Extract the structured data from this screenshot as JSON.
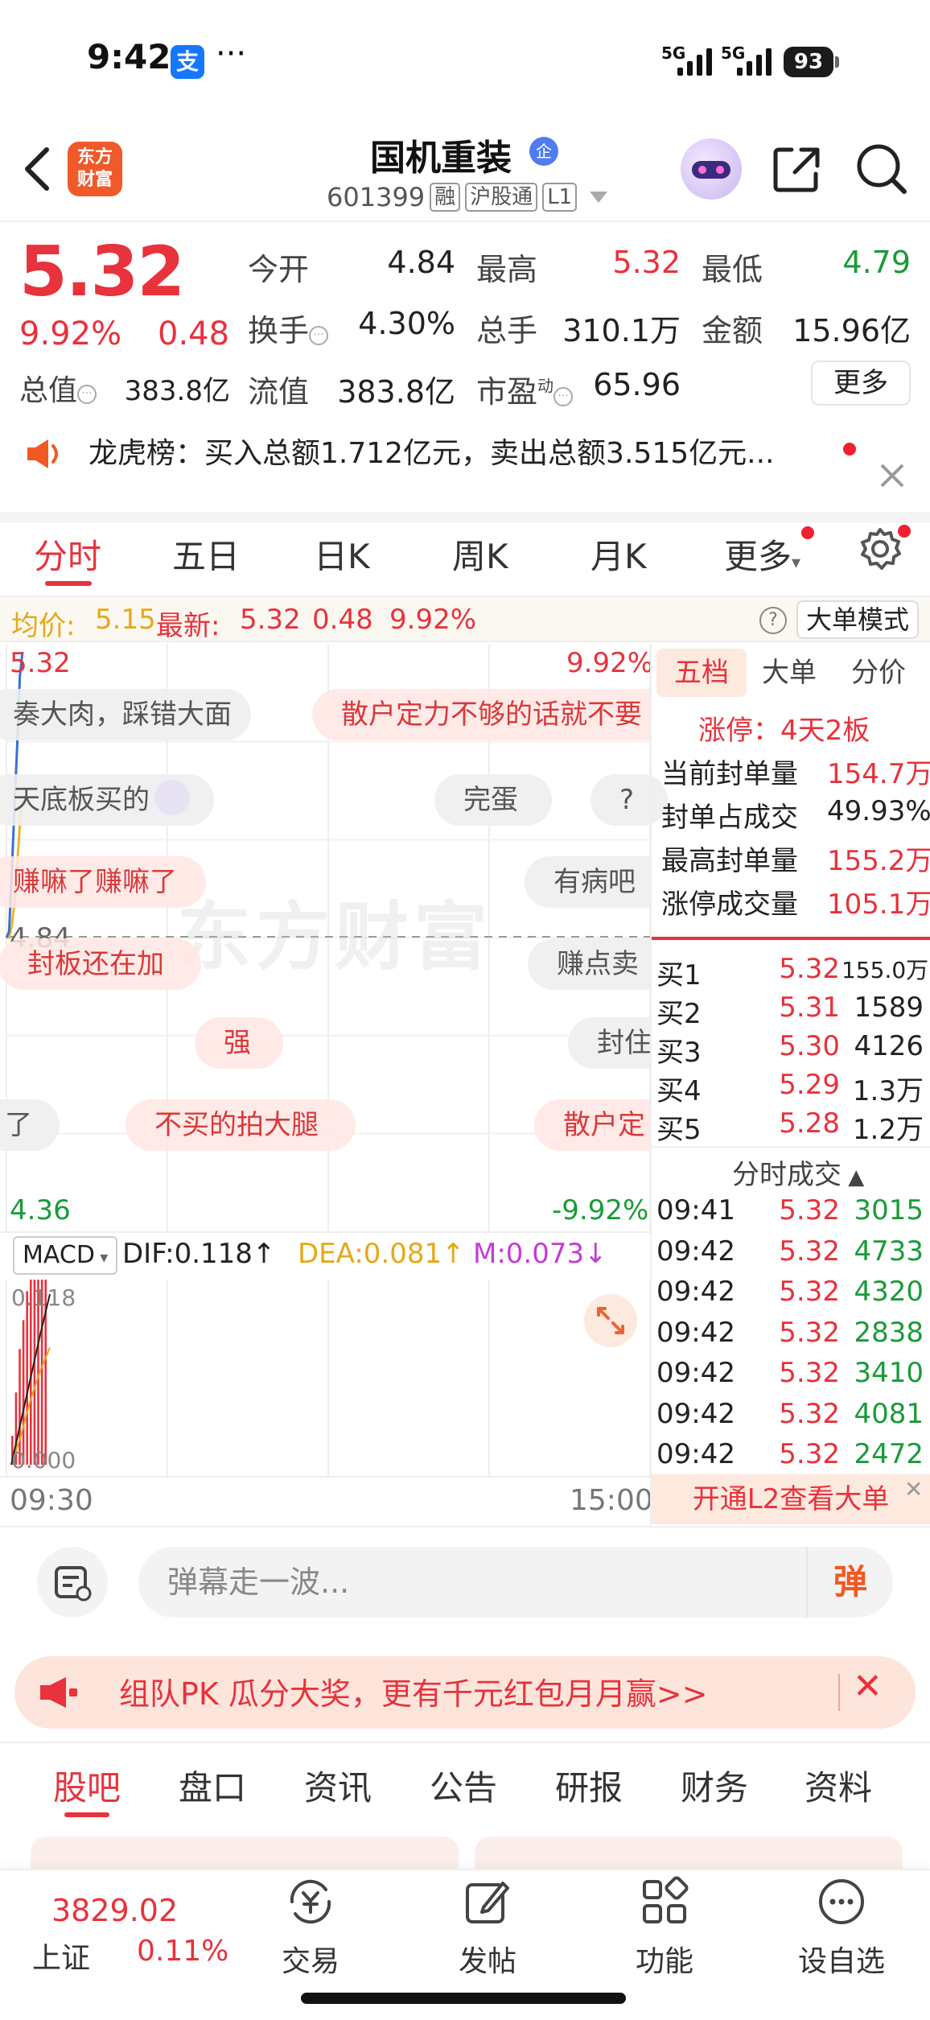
{
  "status_bar": {
    "time": "9:42",
    "alipay": "支",
    "more": "···",
    "net1": "5G",
    "net2": "5G",
    "battery": "93"
  },
  "header": {
    "logo": [
      "东方",
      "财富"
    ],
    "title": "国机重装",
    "badge": "企",
    "code": "601399",
    "tags": [
      "融",
      "沪股通",
      "L1"
    ]
  },
  "quote": {
    "price": "5.32",
    "pct": "9.92%",
    "change": "0.48",
    "rows": [
      [
        {
          "l": "今开",
          "v": "4.84",
          "c": "dark"
        },
        {
          "l": "最高",
          "v": "5.32",
          "c": "red"
        },
        {
          "l": "最低",
          "v": "4.79",
          "c": "green"
        }
      ],
      [
        {
          "l": "换手",
          "v": "4.30%",
          "c": "dark"
        },
        {
          "l": "总手",
          "v": "310.1万",
          "c": "dark"
        },
        {
          "l": "金额",
          "v": "15.96亿",
          "c": "dark"
        }
      ],
      [
        {
          "l": "总值",
          "v": "383.8亿",
          "c": "dark"
        },
        {
          "l": "流值",
          "v": "383.8亿",
          "c": "dark"
        },
        {
          "l": "市盈",
          "v": "65.96",
          "c": "dark"
        }
      ]
    ],
    "pe_sup": "动",
    "more": "更多"
  },
  "notice": {
    "text": "龙虎榜：买入总额1.712亿元，卖出总额3.515亿元..."
  },
  "chart_tabs": [
    "分时",
    "五日",
    "日K",
    "周K",
    "月K",
    "更多"
  ],
  "info_bar": {
    "avg_label": "均价:",
    "avg": "5.15",
    "last_label": "最新:",
    "last": "5.32",
    "chg": "0.48",
    "pct": "9.92%",
    "help": "?",
    "mode": "大单模式"
  },
  "chart_data": {
    "type": "line",
    "title": "",
    "x_range": [
      "09:30",
      "15:00"
    ],
    "y_range": [
      4.36,
      5.32
    ],
    "y_labels": {
      "top_left": "5.32",
      "top_right": "9.92%",
      "mid": "4.84",
      "bottom_left": "4.36",
      "bottom_right": "-9.92%"
    },
    "series": [
      {
        "name": "最新",
        "color": "#3a6fd8",
        "x": [
          "09:30",
          "09:31",
          "09:32",
          "09:33",
          "09:34",
          "09:35",
          "09:36"
        ],
        "y": [
          4.84,
          4.85,
          4.95,
          5.06,
          5.16,
          5.28,
          5.32
        ]
      },
      {
        "name": "均价",
        "color": "#f0b429",
        "x": [
          "09:30",
          "09:31",
          "09:32",
          "09:33",
          "09:34",
          "09:35",
          "09:36"
        ],
        "y": [
          4.84,
          4.84,
          4.86,
          4.9,
          4.96,
          5.03,
          5.08
        ]
      }
    ],
    "macd": {
      "dif": "DIF:0.118↑",
      "dea": "DEA:0.081↑",
      "m": "M:0.073↓",
      "y_labels": {
        "top": "0.118",
        "bottom": "0.000"
      },
      "bars": [
        0.02,
        0.05,
        0.08,
        0.1,
        0.12,
        0.14,
        0.15,
        0.13,
        0.16,
        0.14
      ],
      "dif_line": [
        0.0,
        0.03,
        0.06,
        0.09,
        0.118
      ],
      "dea_line": [
        0.0,
        0.02,
        0.045,
        0.065,
        0.081
      ]
    }
  },
  "bubbles": [
    {
      "t": "奏大肉，踩错大面",
      "c": "g"
    },
    {
      "t": "散户定力不够的话就不要",
      "c": "r"
    },
    {
      "t": "天底板买的",
      "c": "g"
    },
    {
      "t": "完蛋",
      "c": "g"
    },
    {
      "t": "?",
      "c": "g"
    },
    {
      "t": "赚嘛了赚嘛了",
      "c": "r"
    },
    {
      "t": "有病吧",
      "c": "g"
    },
    {
      "t": "封板还在加",
      "c": "r"
    },
    {
      "t": "赚点卖",
      "c": "g"
    },
    {
      "t": "强",
      "c": "r"
    },
    {
      "t": "封住",
      "c": "g"
    },
    {
      "t": "了",
      "c": "g"
    },
    {
      "t": "不买的拍大腿",
      "c": "r"
    },
    {
      "t": "散户定",
      "c": "r"
    }
  ],
  "watermark": "东方财富",
  "macd_select": "MACD",
  "time_axis": [
    "09:30",
    "15:00"
  ],
  "right_panel": {
    "tabs": [
      "五档",
      "大单",
      "分价"
    ],
    "limit": "涨停：4天2板",
    "stats": [
      {
        "l": "当前封单量",
        "v": "154.7万"
      },
      {
        "l": "封单占成交",
        "v": "49.93%"
      },
      {
        "l": "最高封单量",
        "v": "155.2万"
      },
      {
        "l": "涨停成交量",
        "v": "105.1万"
      }
    ],
    "bids": [
      {
        "l": "买1",
        "p": "5.32",
        "v": "155.0万"
      },
      {
        "l": "买2",
        "p": "5.31",
        "v": "1589"
      },
      {
        "l": "买3",
        "p": "5.30",
        "v": "4126"
      },
      {
        "l": "买4",
        "p": "5.29",
        "v": "1.3万"
      },
      {
        "l": "买5",
        "p": "5.28",
        "v": "1.2万"
      }
    ],
    "ticks_title": "分时成交",
    "ticks": [
      {
        "t": "09:41",
        "p": "5.32",
        "v": "3015"
      },
      {
        "t": "09:42",
        "p": "5.32",
        "v": "4733"
      },
      {
        "t": "09:42",
        "p": "5.32",
        "v": "4320"
      },
      {
        "t": "09:42",
        "p": "5.32",
        "v": "2838"
      },
      {
        "t": "09:42",
        "p": "5.32",
        "v": "3410"
      },
      {
        "t": "09:42",
        "p": "5.32",
        "v": "4081"
      },
      {
        "t": "09:42",
        "p": "5.32",
        "v": "2472"
      }
    ],
    "l2": "开通L2查看大单"
  },
  "comment": {
    "placeholder": "弹幕走一波...",
    "dan": "弹"
  },
  "promo": {
    "text": "组队PK 瓜分大奖，更有千元红包月月赢>>"
  },
  "section_tabs": [
    "股吧",
    "盘口",
    "资讯",
    "公告",
    "研报",
    "财务",
    "资料"
  ],
  "bottom_nav": {
    "index_value": "3829.02",
    "index_name": "上证",
    "index_pct": "0.11%",
    "items": [
      "交易",
      "发帖",
      "功能",
      "设自选"
    ]
  },
  "colors": {
    "up": "#e8323c",
    "down": "#1a9b3a",
    "accent": "#f0592a"
  }
}
